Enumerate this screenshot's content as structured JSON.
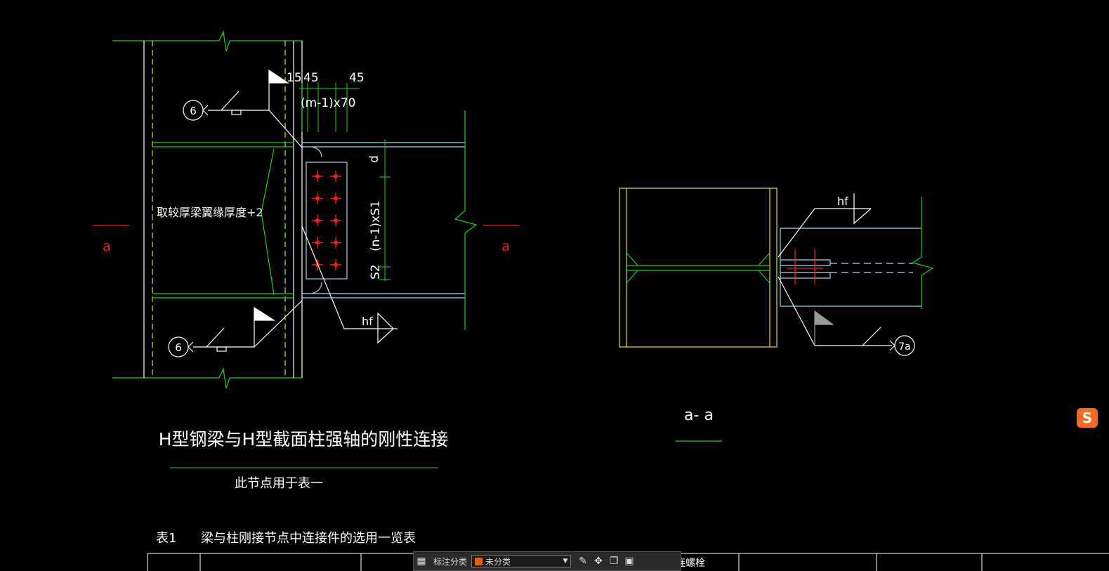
{
  "app": {
    "type": "CAD drawing viewer"
  },
  "drawing": {
    "title": "H型钢梁与H型截面柱强轴的刚性连接",
    "subtitle": "此节点用于表一",
    "section_view_label": "a- a",
    "section_mark_left": "a",
    "section_mark_right": "a",
    "note_flange": "取较厚梁翼缘厚度+2",
    "weld_ref_top": "6",
    "weld_ref_bottom": "6",
    "weld_ref_section": "7a",
    "weld_size_main": "hf",
    "weld_size_section": "hf",
    "dim_15": "15",
    "dim_45_left": "45",
    "dim_45_right": "45",
    "dim_m70": "(m-1)x70",
    "dim_d": "d",
    "dim_n_s1": "(n-1)xS1",
    "dim_s2": "S2",
    "colors": {
      "green": "#17d217",
      "yellow": "#e6e600",
      "cyan": "#9ad9f0",
      "red": "#ff1a1a",
      "white": "#ffffff"
    }
  },
  "table": {
    "caption_no": "表1",
    "caption": "梁与柱刚接节点中连接件的选用一览表",
    "partial_cell": "连螺栓"
  },
  "toolbar": {
    "grid_icon": "grid-icon",
    "label": "标注分类",
    "dropdown_value": "未分类",
    "icons": [
      "edit-icon",
      "move-icon",
      "copy-icon",
      "paste-icon"
    ]
  },
  "ime": {
    "logo_letter": "S"
  }
}
